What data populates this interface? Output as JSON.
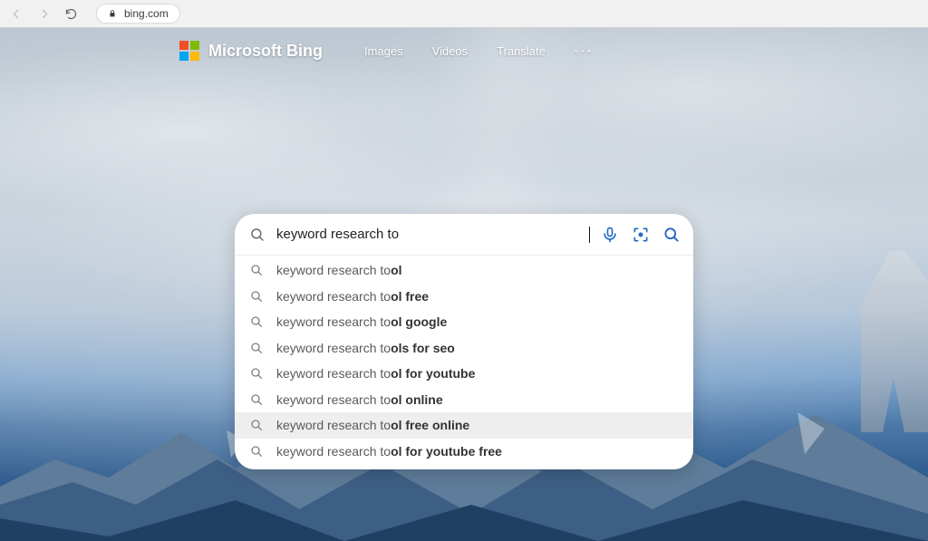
{
  "browser": {
    "url_host": "bing.com"
  },
  "header": {
    "brand": "Microsoft Bing",
    "links": [
      "Images",
      "Videos",
      "Translate"
    ]
  },
  "search": {
    "query": "keyword research to",
    "suggestions": [
      {
        "prefix": "keyword research to",
        "bold": "ol"
      },
      {
        "prefix": "keyword research to",
        "bold": "ol free"
      },
      {
        "prefix": "keyword research to",
        "bold": "ol google"
      },
      {
        "prefix": "keyword research to",
        "bold": "ols for seo"
      },
      {
        "prefix": "keyword research to",
        "bold": "ol for youtube"
      },
      {
        "prefix": "keyword research to",
        "bold": "ol online"
      },
      {
        "prefix": "keyword research to",
        "bold": "ol free online"
      },
      {
        "prefix": "keyword research to",
        "bold": "ol for youtube free"
      }
    ],
    "hovered_index": 6
  },
  "icons": {
    "back": "back-icon",
    "forward": "forward-icon",
    "reload": "reload-icon",
    "lock": "lock-icon",
    "search": "search-icon",
    "mic": "mic-icon",
    "lens": "lens-icon",
    "go": "search-submit-icon",
    "more": "more-icon"
  }
}
